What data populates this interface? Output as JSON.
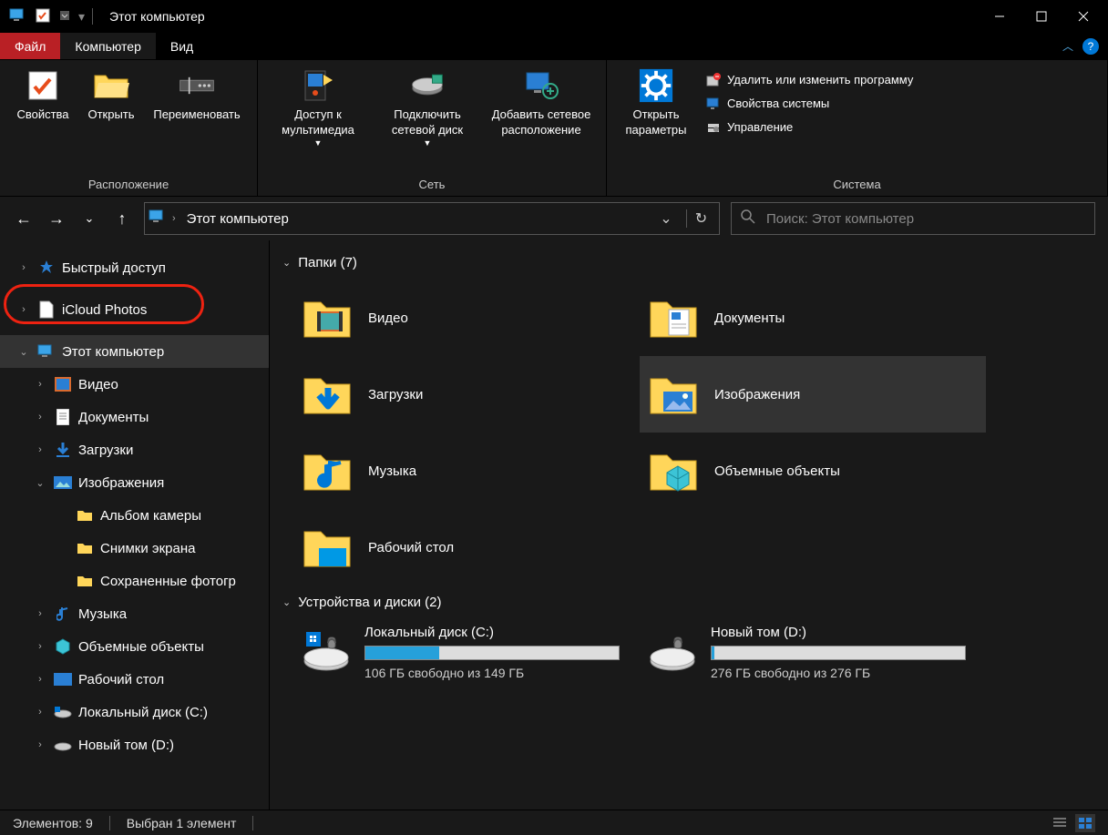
{
  "window": {
    "title": "Этот компьютер"
  },
  "tabs": {
    "file": "Файл",
    "computer": "Компьютер",
    "view": "Вид"
  },
  "ribbon": {
    "location": {
      "properties": "Свойства",
      "open": "Открыть",
      "rename": "Переименовать",
      "group": "Расположение"
    },
    "network": {
      "media": "Доступ к мультимедиа",
      "mapdrive": "Подключить сетевой диск",
      "addloc": "Добавить сетевое расположение",
      "group": "Сеть"
    },
    "system": {
      "settings": "Открыть параметры",
      "uninstall": "Удалить или изменить программу",
      "sysprops": "Свойства системы",
      "manage": "Управление",
      "group": "Система"
    }
  },
  "address": {
    "crumb": "Этот компьютер"
  },
  "search": {
    "placeholder": "Поиск: Этот компьютер"
  },
  "tree": {
    "quick": "Быстрый доступ",
    "icloud": "iCloud Photos",
    "thispc": "Этот компьютер",
    "video": "Видео",
    "documents": "Документы",
    "downloads": "Загрузки",
    "pictures": "Изображения",
    "camera": "Альбом камеры",
    "screenshots": "Снимки экрана",
    "saved": "Сохраненные фотогр",
    "music": "Музыка",
    "objects3d": "Объемные объекты",
    "desktop": "Рабочий стол",
    "cdrive": "Локальный диск (C:)",
    "ddrive": "Новый том (D:)"
  },
  "sections": {
    "folders": "Папки (7)",
    "drives": "Устройства и диски (2)"
  },
  "folders": {
    "video": "Видео",
    "documents": "Документы",
    "downloads": "Загрузки",
    "pictures": "Изображения",
    "music": "Музыка",
    "objects3d": "Объемные объекты",
    "desktop": "Рабочий стол"
  },
  "drives": {
    "c": {
      "name": "Локальный диск (C:)",
      "free": "106 ГБ свободно из 149 ГБ",
      "used_pct": 29
    },
    "d": {
      "name": "Новый том (D:)",
      "free": "276 ГБ свободно из 276 ГБ",
      "used_pct": 1
    }
  },
  "status": {
    "count": "Элементов: 9",
    "selected": "Выбран 1 элемент"
  }
}
